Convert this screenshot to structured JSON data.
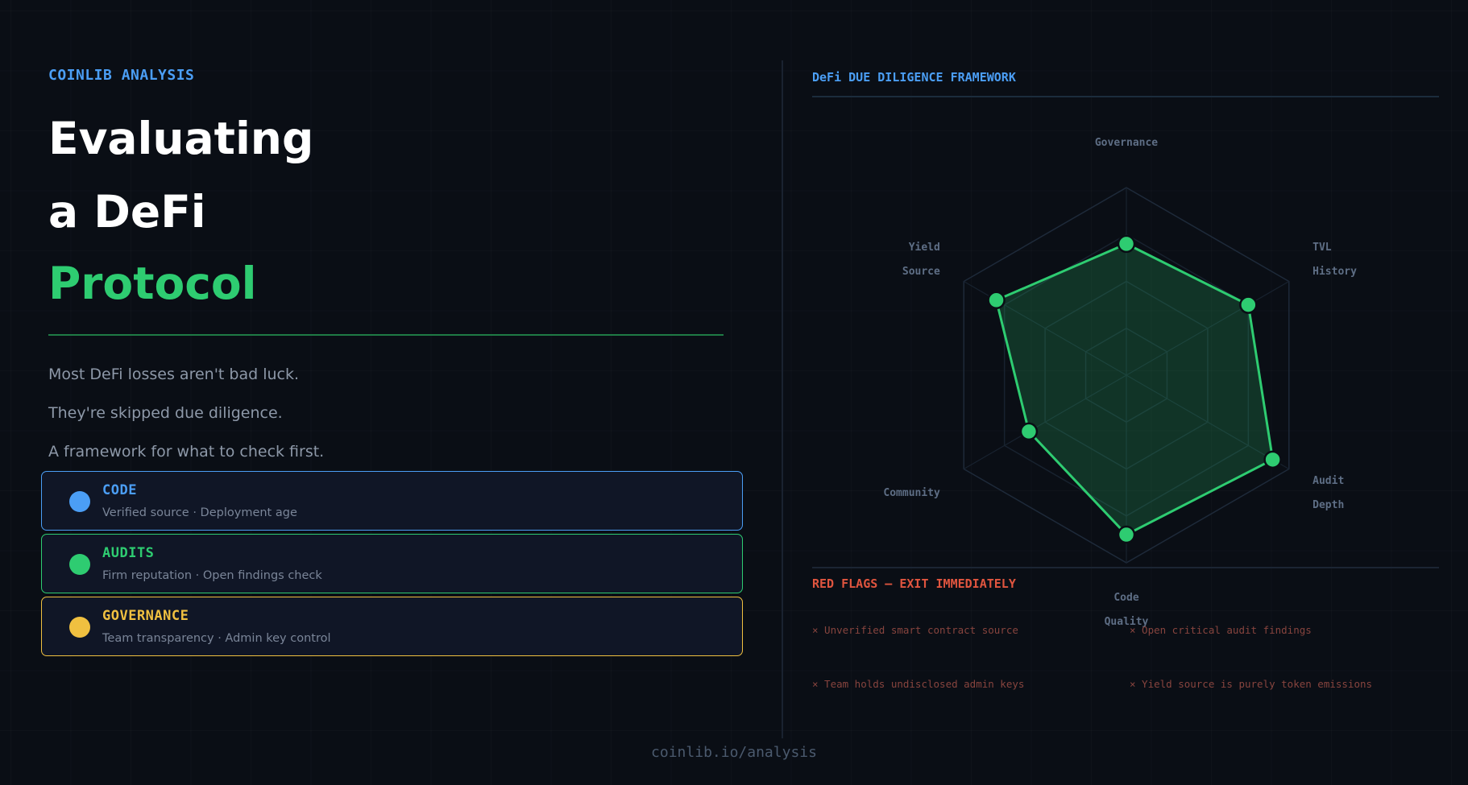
{
  "left": {
    "eyebrow": "COINLIB ANALYSIS",
    "title_line1": "Evaluating",
    "title_line2": "a DeFi",
    "title_line3": "Protocol",
    "intro": [
      "Most DeFi losses aren't bad luck.",
      "They're skipped due diligence.",
      "A framework for what to check first."
    ],
    "cards": [
      {
        "title": "CODE",
        "desc": "Verified source · Deployment age",
        "color": "#4b9ef5"
      },
      {
        "title": "AUDITS",
        "desc": "Firm reputation · Open findings check",
        "color": "#2ecc71"
      },
      {
        "title": "GOVERNANCE",
        "desc": "Team transparency · Admin key control",
        "color": "#f0c040"
      }
    ]
  },
  "right": {
    "framework_title": "DeFi DUE DILIGENCE FRAMEWORK",
    "red_flags_title": "RED FLAGS — EXIT IMMEDIATELY",
    "red_flags": [
      "×  Unverified smart contract source",
      "×  Open critical audit findings",
      "×  Team holds undisclosed admin keys",
      "×  Yield source is purely token emissions"
    ]
  },
  "chart_data": {
    "type": "radar",
    "axes": [
      [
        "Governance"
      ],
      [
        "TVL",
        "History"
      ],
      [
        "Audit",
        "Depth"
      ],
      [
        "Code",
        "Quality"
      ],
      [
        "Community"
      ],
      [
        "Yield",
        "Source"
      ]
    ],
    "values": [
      0.7,
      0.75,
      0.9,
      0.85,
      0.6,
      0.8
    ],
    "max": 1,
    "rings": 4
  },
  "colors": {
    "accent_blue": "#4b9ef5",
    "accent_green": "#2ecc71",
    "accent_yellow": "#f0c040",
    "red_flag": "#e0553f"
  },
  "footer": "coinlib.io/analysis"
}
